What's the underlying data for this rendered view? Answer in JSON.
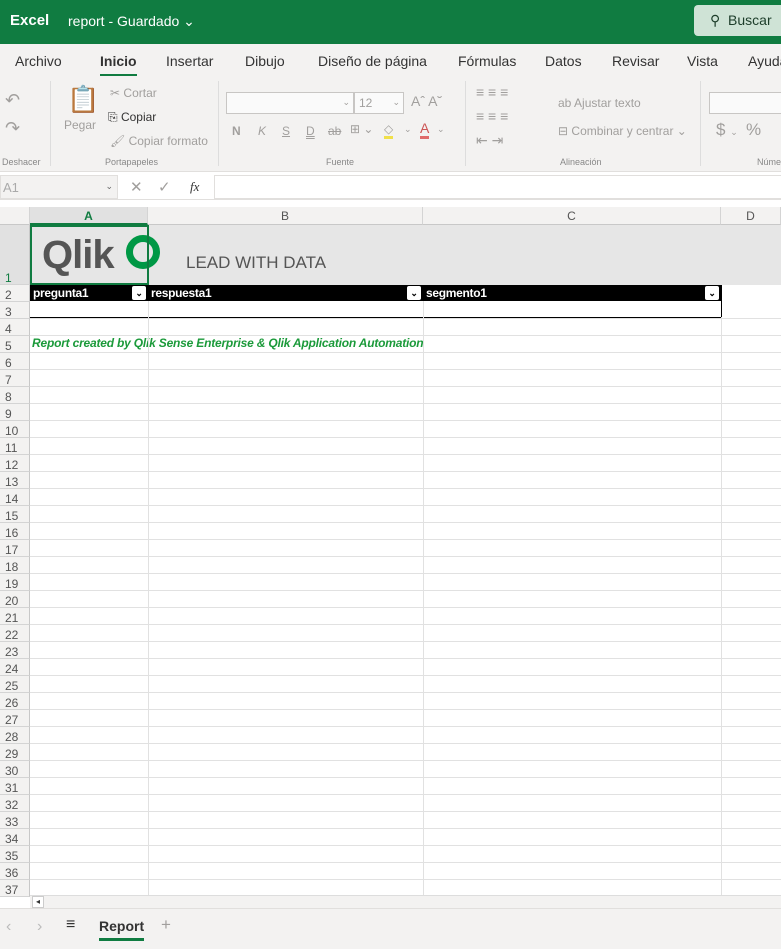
{
  "titlebar": {
    "app": "Excel",
    "document": "report - Guardado",
    "search": "Buscar"
  },
  "tabs": [
    "Archivo",
    "Inicio",
    "Insertar",
    "Dibujo",
    "Diseño de página",
    "Fórmulas",
    "Datos",
    "Revisar",
    "Vista",
    "Ayuda"
  ],
  "active_tab": "Inicio",
  "ribbon": {
    "cut": "Cortar",
    "copy": "Copiar",
    "format_painter": "Copiar formato",
    "paste": "Pegar",
    "font_size": "12",
    "wrap_text": "Ajustar texto",
    "merge": "Combinar y centrar",
    "bold": "N",
    "italic": "K",
    "underline": "S",
    "double_underline": "D",
    "strike": "ab",
    "currency": "$",
    "percent": "%",
    "groups": {
      "undo": "Deshacer",
      "clipboard": "Portapapeles",
      "font": "Fuente",
      "alignment": "Alineación",
      "number": "Núme"
    }
  },
  "formula_bar": {
    "name_box": "A1",
    "fx": "fx",
    "value": ""
  },
  "columns": [
    "A",
    "B",
    "C",
    "D"
  ],
  "row_count": 37,
  "logo": {
    "brand": "Qlik",
    "tagline": "LEAD WITH DATA"
  },
  "table_headers": [
    "pregunta1",
    "respuesta1",
    "segmento1"
  ],
  "footer_note": "Report created by Qlik Sense Enterprise & Qlik Application Automation",
  "sheet_tabs": [
    "Report"
  ],
  "colors": {
    "brand": "#107c41",
    "qlik_green": "#009845",
    "note": "#1b9a3a"
  }
}
